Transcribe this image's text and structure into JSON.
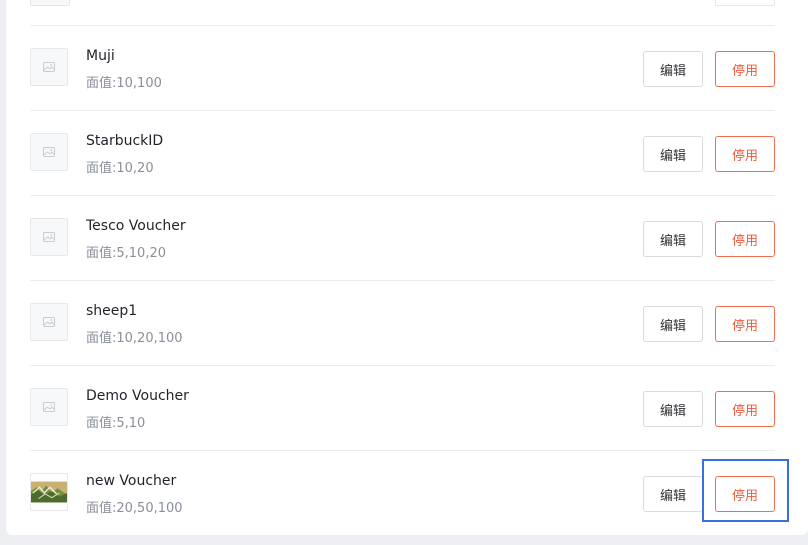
{
  "vouchers": [
    {
      "name": "Muji",
      "value": "面值:10,100",
      "has_image": false
    },
    {
      "name": "StarbuckID",
      "value": "面值:10,20",
      "has_image": false
    },
    {
      "name": "Tesco Voucher",
      "value": "面值:5,10,20",
      "has_image": false
    },
    {
      "name": "sheep1",
      "value": "面值:10,20,100",
      "has_image": false
    },
    {
      "name": "Demo Voucher",
      "value": "面值:5,10",
      "has_image": false
    },
    {
      "name": "new Voucher",
      "value": "面值:20,50,100",
      "has_image": true
    }
  ],
  "actions": {
    "edit_label": "编辑",
    "disable_label": "停用"
  },
  "colors": {
    "accent_red": "#ee5a3a",
    "highlight_blue": "#3a6fe0"
  },
  "icons": {
    "placeholder": "image-placeholder-icon",
    "voucher_image": "voucher-image-thumbnail"
  }
}
